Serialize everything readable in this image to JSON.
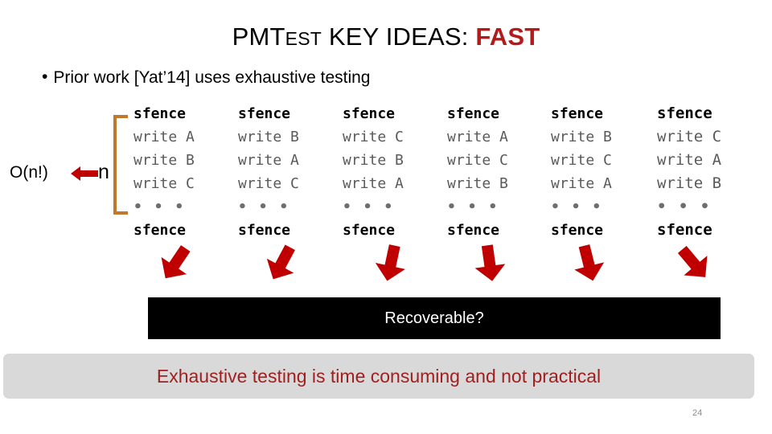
{
  "slide": {
    "title": {
      "prefix": "PMT",
      "smallcaps": "EST",
      "middle": " KEY IDEAS: ",
      "highlight": "FAST"
    },
    "bullet": {
      "marker": "•",
      "text": "Prior work [Yat’14] uses exhaustive testing"
    },
    "annotation": {
      "complexity": "O(n!)",
      "arrow_icon": "left-arrow-icon",
      "n_label": "n",
      "bracket_icon": "left-bracket-icon",
      "bracket_color": "#C0782A"
    },
    "code_columns": [
      {
        "lines": [
          "sfence",
          "write A",
          "write B",
          "write C",
          "• • •",
          "sfence"
        ]
      },
      {
        "lines": [
          "sfence",
          "write B",
          "write A",
          "write C",
          "• • •",
          "sfence"
        ]
      },
      {
        "lines": [
          "sfence",
          "write C",
          "write B",
          "write A",
          "• • •",
          "sfence"
        ]
      },
      {
        "lines": [
          "sfence",
          "write A",
          "write C",
          "write B",
          "• • •",
          "sfence"
        ]
      },
      {
        "lines": [
          "sfence",
          "write B",
          "write C",
          "write A",
          "• • •",
          "sfence"
        ]
      },
      {
        "lines": [
          "sfence",
          "write C",
          "write A",
          "write B",
          "• • •",
          "sfence"
        ]
      }
    ],
    "arrows": {
      "icon": "down-arrow-icon",
      "color": "#C00000",
      "count": 6
    },
    "recoverable_bar": {
      "label": "Recoverable?",
      "background": "#000000",
      "text_color": "#FFFFFF"
    },
    "callout": {
      "text": "Exhaustive testing is time consuming and not practical",
      "background": "#D9D9D9",
      "text_color": "#A02020"
    },
    "page_number": "24"
  }
}
